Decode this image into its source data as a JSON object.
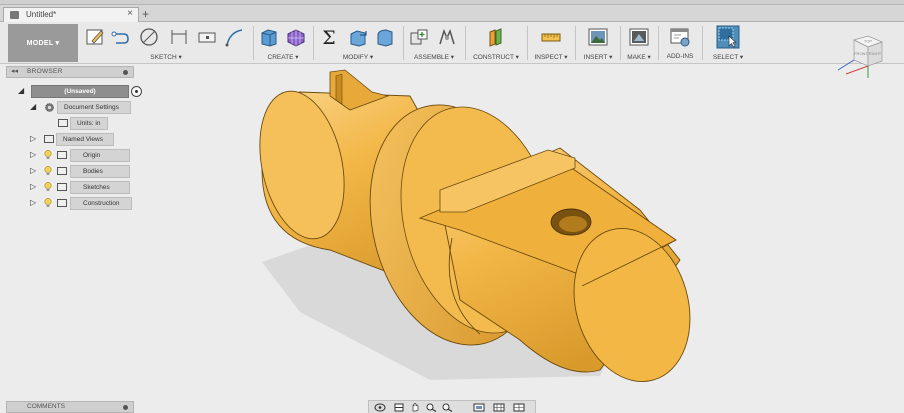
{
  "tab": {
    "title": "Untitled*",
    "close_glyph": "×",
    "new_tab_glyph": "+"
  },
  "toolbar": {
    "workspace": "MODEL ▾",
    "groups": [
      {
        "label": "SKETCH ▾"
      },
      {
        "label": "CREATE ▾"
      },
      {
        "label": "MODIFY ▾"
      },
      {
        "label": "ASSEMBLE ▾"
      },
      {
        "label": "CONSTRUCT ▾"
      },
      {
        "label": "INSPECT ▾"
      },
      {
        "label": "INSERT ▾"
      },
      {
        "label": "MAKE ▾"
      },
      {
        "label": "ADD-INS"
      },
      {
        "label": "SELECT ▾"
      }
    ]
  },
  "viewcube": {
    "top": "TOP",
    "front": "FRONT",
    "right": "RIGHT"
  },
  "browser": {
    "title": "BROWSER",
    "collapse_glyph": "◂◂",
    "root": "(Unsaved)",
    "doc_settings": "Document Settings",
    "units": "Units: in",
    "items": [
      "Named Views",
      "Origin",
      "Bodies",
      "Sketches",
      "Construction"
    ]
  },
  "comments": {
    "title": "COMMENTS"
  },
  "colors": {
    "body": "#f0b542",
    "body_dark": "#c98a1c",
    "body_light": "#fad07a",
    "shadow": "#d7d7d7",
    "accent": "#4f8eb8"
  }
}
